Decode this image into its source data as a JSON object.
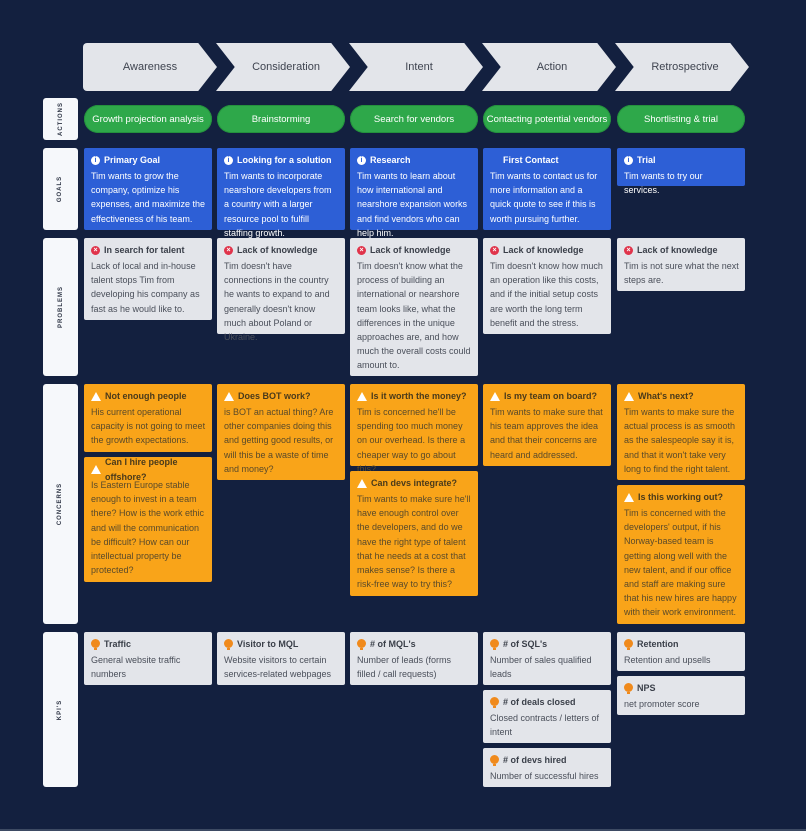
{
  "colors": {
    "background": "#13203f",
    "stage": "#e3e5ea",
    "action": "#2ea84a",
    "goal": "#2d5fd6",
    "problem": "#e3e5ea",
    "concern": "#f9a419",
    "kpi_icon": "#f08a1c",
    "problem_icon": "#e0344b"
  },
  "stages": [
    "Awareness",
    "Consideration",
    "Intent",
    "Action",
    "Retrospective"
  ],
  "row_labels": {
    "actions": "ACTIONS",
    "goals": "GOALS",
    "problems": "PROBLEMS",
    "concerns": "CONCERNS",
    "kpis": "KPI'S"
  },
  "actions": [
    "Growth projection analysis",
    "Brainstorming",
    "Search for vendors",
    "Contacting potential vendors",
    "Shortlisting & trial"
  ],
  "goals": [
    {
      "icon": "info-icon",
      "title": "Primary Goal",
      "body": "Tim wants to grow the company, optimize his expenses, and maximize the effectiveness of his team."
    },
    {
      "icon": "info-icon",
      "title": "Looking for a solution",
      "body": "Tim wants to incorporate nearshore developers from a country with a larger resource pool to fulfill staffing growth."
    },
    {
      "icon": "info-icon",
      "title": "Research",
      "body": "Tim wants to learn about how international and nearshore expansion works and find vendors who can help him."
    },
    {
      "icon": "none",
      "title": "First Contact",
      "body": "Tim wants to contact us for more information and a quick quote to see if this is worth pursuing further."
    },
    {
      "icon": "info-icon",
      "title": "Trial",
      "body": "Tim wants to try our services."
    }
  ],
  "problems": [
    {
      "icon": "x-circle-icon",
      "title": "In search for talent",
      "body": "Lack of local and in-house talent stops Tim from developing his company as fast as he would like to."
    },
    {
      "icon": "x-circle-icon",
      "title": "Lack of knowledge",
      "body": "Tim doesn't have connections in the country he wants to expand to and generally doesn't know much about Poland or Ukraine."
    },
    {
      "icon": "x-circle-icon",
      "title": "Lack of knowledge",
      "body": "Tim doesn't know what the process of building an international or nearshore team looks like, what the differences in the unique approaches are, and how much the overall costs could amount to."
    },
    {
      "icon": "x-circle-icon",
      "title": "Lack of knowledge",
      "body": "Tim doesn't know how much an operation like this costs, and if the initial setup costs are worth the long term benefit and the stress."
    },
    {
      "icon": "x-circle-icon",
      "title": "Lack of knowledge",
      "body": "Tim is not sure what the next steps are."
    }
  ],
  "concerns": [
    [
      {
        "title": "Not enough people",
        "body": "His current operational capacity is not going to meet the growth expectations."
      },
      {
        "title": "Can I hire people offshore?",
        "body": "Is Eastern Europe stable enough to invest in a team there? How is the work ethic and will the communication be difficult? How can our intellectual property be protected?"
      }
    ],
    [
      {
        "title": "Does BOT work?",
        "body": "is BOT an actual thing? Are other companies doing this and getting good results, or will this be a waste of time and money?"
      }
    ],
    [
      {
        "title": "Is it worth the money?",
        "body": "Tim is concerned he'll be spending too much money on our overhead. Is there a cheaper way to go about this?"
      },
      {
        "title": "Can devs integrate?",
        "body": "Tim wants to make sure he'll have enough control over the developers, and do we have the right type of talent that he needs at a cost that makes sense? Is there a risk-free way to try this?"
      }
    ],
    [
      {
        "title": "Is my team on board?",
        "body": "Tim wants to make sure that his team approves the idea and that their concerns are heard and addressed."
      }
    ],
    [
      {
        "title": "What's next?",
        "body": "Tim wants to make sure the actual process is as smooth as the salespeople say it is, and that it won't take very long to find the right talent."
      },
      {
        "title": "Is this working out?",
        "body": "Tim is concerned with the developers' output, if his Norway-based team is getting along well with the new talent, and if our office and staff are making sure that his new hires are happy with their work environment."
      }
    ]
  ],
  "kpis": [
    [
      {
        "title": "Traffic",
        "body": "General website traffic numbers"
      }
    ],
    [
      {
        "title": "Visitor to MQL",
        "body": "Website visitors to certain services-related webpages"
      }
    ],
    [
      {
        "title": "# of MQL's",
        "body": "Number of leads (forms filled / call requests)"
      }
    ],
    [
      {
        "title": "# of SQL's",
        "body": "Number of sales qualified leads"
      },
      {
        "title": "# of deals closed",
        "body": "Closed contracts / letters of intent"
      },
      {
        "title": "# of devs hired",
        "body": "Number of successful hires"
      }
    ],
    [
      {
        "title": "Retention",
        "body": "Retention and upsells"
      },
      {
        "title": "NPS",
        "body": "net promoter score"
      }
    ]
  ]
}
